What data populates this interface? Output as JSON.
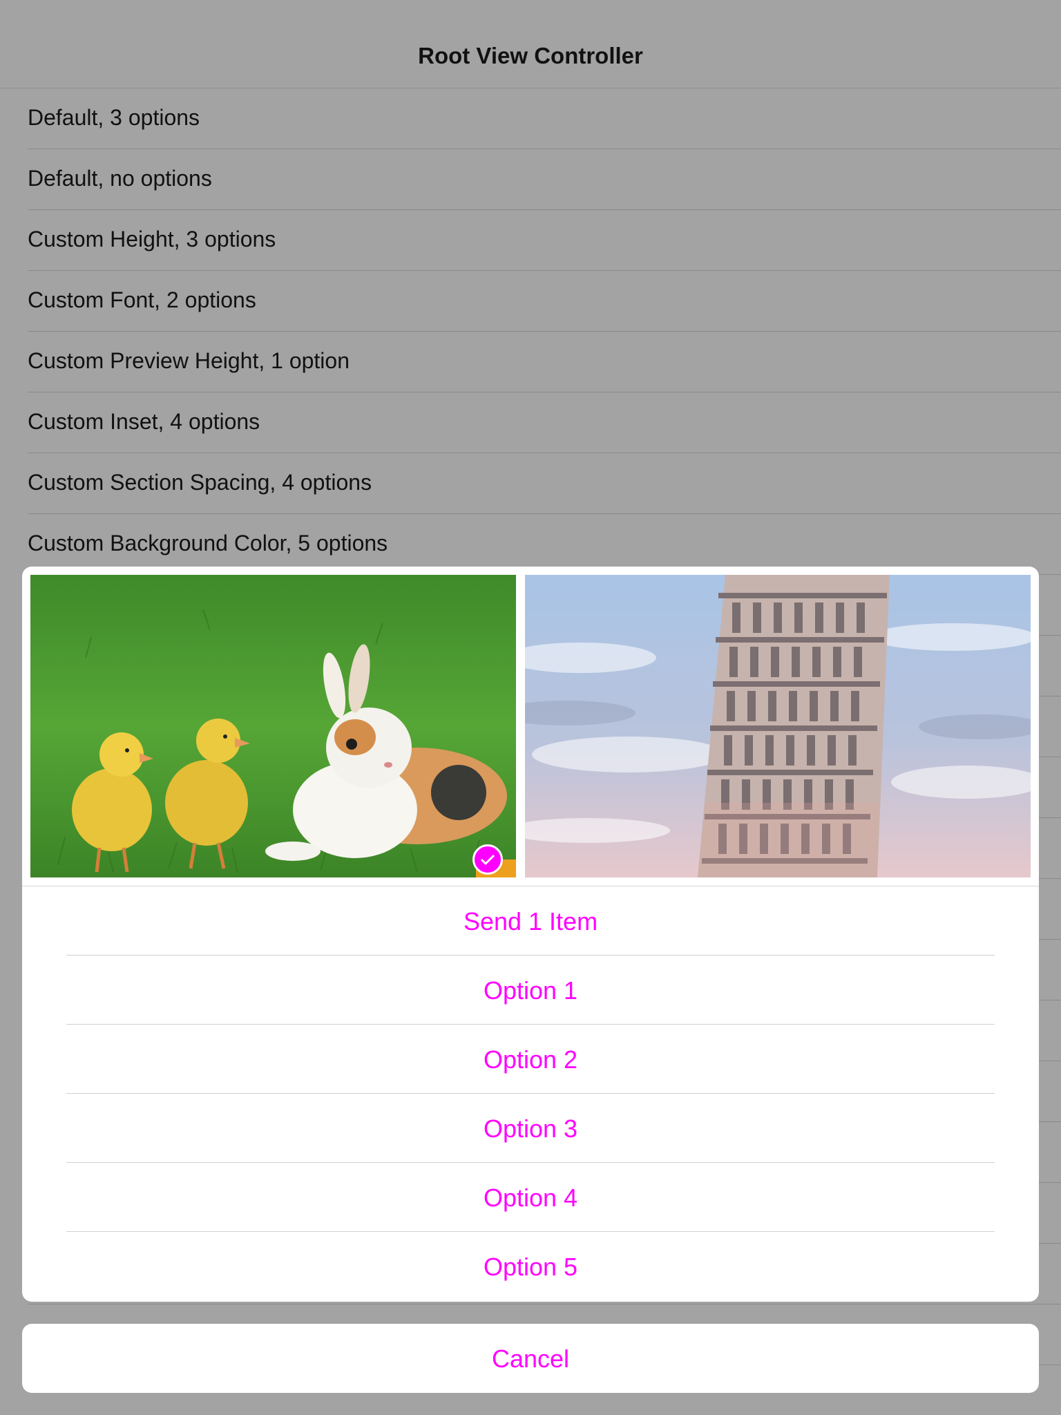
{
  "nav": {
    "title": "Root View Controller"
  },
  "rows": [
    "Default, 3 options",
    "Default, no options",
    "Custom Height, 3 options",
    "Custom Font, 2 options",
    "Custom Preview Height, 1 option",
    "Custom Inset, 4 options",
    "Custom Section Spacing, 4 options",
    "Custom Background Color, 5 options"
  ],
  "sheet": {
    "photos": [
      {
        "name": "ducklings-and-rabbit-photo",
        "selected": true
      },
      {
        "name": "leaning-tower-photo",
        "selected": false
      }
    ],
    "actions": [
      "Send 1 Item",
      "Option 1",
      "Option 2",
      "Option 3",
      "Option 4",
      "Option 5"
    ],
    "cancel": "Cancel"
  },
  "colors": {
    "accent": "#ff00ff",
    "dim_background": "#a3a3a3",
    "sheet_background": "#ffffff"
  }
}
